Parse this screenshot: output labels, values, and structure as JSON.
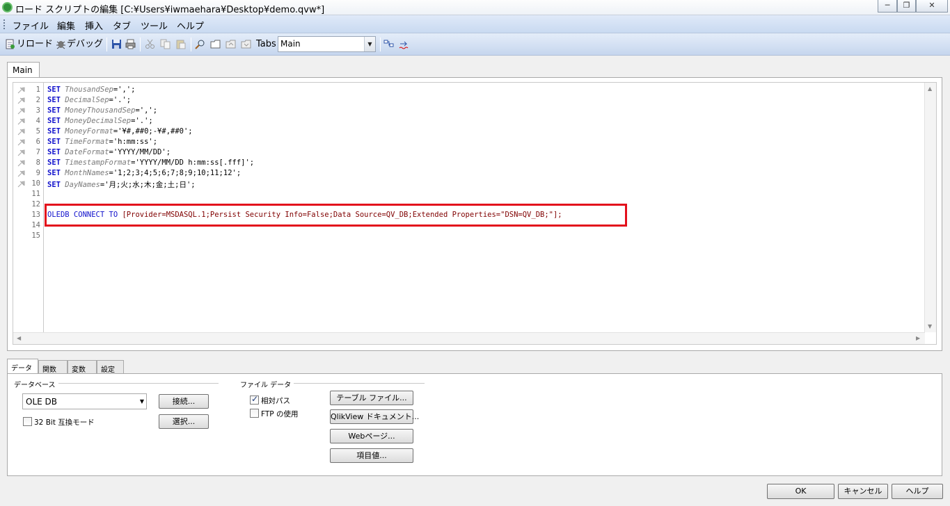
{
  "window": {
    "title": "ロード スクリプトの編集 [C:¥Users¥iwmaehara¥Desktop¥demo.qvw*]",
    "minimize": "─",
    "restore": "❐",
    "close": "✕"
  },
  "menu": [
    "ファイル",
    "編集",
    "挿入",
    "タブ",
    "ツール",
    "ヘルプ"
  ],
  "toolbar": {
    "reload": "リロード",
    "debug": "デバッグ",
    "tabs_label": "Tabs",
    "tab_select_value": "Main"
  },
  "script_tab": "Main",
  "editor": {
    "line_numbers": [
      "1",
      "2",
      "3",
      "4",
      "5",
      "6",
      "7",
      "8",
      "9",
      "10",
      "11",
      "12",
      "13",
      "14",
      "15"
    ],
    "lines": [
      {
        "kw": "SET",
        "var": "ThousandSep",
        "val": "=',';"
      },
      {
        "kw": "SET",
        "var": "DecimalSep",
        "val": "='.';"
      },
      {
        "kw": "SET",
        "var": "MoneyThousandSep",
        "val": "=',';"
      },
      {
        "kw": "SET",
        "var": "MoneyDecimalSep",
        "val": "='.';"
      },
      {
        "kw": "SET",
        "var": "MoneyFormat",
        "val": "='¥#,##0;-¥#,##0';"
      },
      {
        "kw": "SET",
        "var": "TimeFormat",
        "val": "='h:mm:ss';"
      },
      {
        "kw": "SET",
        "var": "DateFormat",
        "val": "='YYYY/MM/DD';"
      },
      {
        "kw": "SET",
        "var": "TimestampFormat",
        "val": "='YYYY/MM/DD h:mm:ss[.fff]';"
      },
      {
        "kw": "SET",
        "var": "MonthNames",
        "val": "='1;2;3;4;5;6;7;8;9;10;11;12';"
      },
      {
        "kw": "SET",
        "var": "DayNames",
        "val": "='月;火;水;木;金;土;日';"
      }
    ],
    "connect_line": {
      "kw": "OLEDB CONNECT TO",
      "rest": " [Provider=MSDASQL.1;Persist Security Info=False;Data Source=QV_DB;Extended Properties=\"DSN=QV_DB;\"];"
    }
  },
  "bottom_tabs": [
    "データ",
    "関数",
    "変数",
    "設定"
  ],
  "database": {
    "group_label": "データベース",
    "selected": "OLE DB",
    "connect_button": "接続...",
    "select_button": "選択...",
    "bit32_label": "32 Bit 互換モード",
    "bit32_checked": false
  },
  "file_data": {
    "group_label": "ファイル データ",
    "relative_path_label": "相対パス",
    "relative_path_checked": true,
    "ftp_label": "FTP の使用",
    "ftp_checked": false,
    "buttons": [
      "テーブル ファイル...",
      "QlikView ドキュメント...",
      "Webページ...",
      "項目値..."
    ]
  },
  "dialog_buttons": {
    "ok": "OK",
    "cancel": "キャンセル",
    "help": "ヘルプ"
  }
}
